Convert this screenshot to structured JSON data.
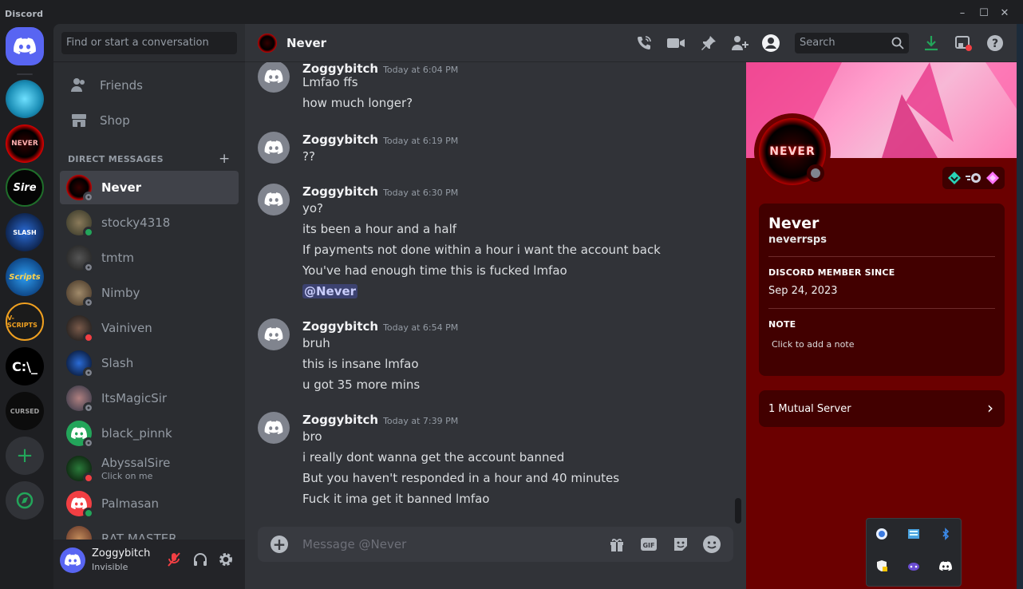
{
  "window": {
    "title": "Discord"
  },
  "dm_sidebar": {
    "search_placeholder": "Find or start a conversation",
    "nav": [
      {
        "label": "Friends"
      },
      {
        "label": "Shop"
      }
    ],
    "section_label": "DIRECT MESSAGES",
    "dms": [
      {
        "name": "Never",
        "status": "offline",
        "active": true
      },
      {
        "name": "stocky4318",
        "status": "online"
      },
      {
        "name": "tmtm",
        "status": "offline"
      },
      {
        "name": "Nimby",
        "status": "offline"
      },
      {
        "name": "Vainiven",
        "status": "dnd"
      },
      {
        "name": "Slash",
        "status": "offline"
      },
      {
        "name": "ItsMagicSir",
        "status": "offline"
      },
      {
        "name": "black_pinnk",
        "status": "offline"
      },
      {
        "name": "AbyssalSire",
        "sub": "Click on me",
        "status": "dnd"
      },
      {
        "name": "Palmasan",
        "status": "online"
      },
      {
        "name": "RAT MASTER",
        "status": "offline"
      }
    ]
  },
  "user_panel": {
    "name": "Zoggybitch",
    "status": "Invisible"
  },
  "chat": {
    "header_name": "Never",
    "search_placeholder": "Search",
    "composer_placeholder": "Message @Never",
    "messages": [
      {
        "user": "Zoggybitch",
        "time": "Today at 6:04 PM",
        "lines": [
          "Lmfao ffs",
          "how much longer?"
        ]
      },
      {
        "user": "Zoggybitch",
        "time": "Today at 6:19 PM",
        "lines": [
          "??"
        ]
      },
      {
        "user": "Zoggybitch",
        "time": "Today at 6:30 PM",
        "lines": [
          "yo?",
          "its been a hour and a half",
          "If payments not done within a hour i want the account back",
          "You've had enough time this is fucked lmfao"
        ],
        "mention": "@Never"
      },
      {
        "user": "Zoggybitch",
        "time": "Today at 6:54 PM",
        "lines": [
          "bruh",
          "this is insane lmfao",
          "u got 35 more mins"
        ]
      },
      {
        "user": "Zoggybitch",
        "time": "Today at 7:39 PM",
        "lines": [
          "bro",
          "i really dont wanna get the account banned",
          "But you haven't responded in a hour and 40 minutes",
          "Fuck it ima get it banned lmfao"
        ]
      }
    ]
  },
  "profile": {
    "avatar_text": "NEVER",
    "name": "Never",
    "handle": "neverrsps",
    "member_since_label": "DISCORD MEMBER SINCE",
    "member_since": "Sep 24, 2023",
    "note_label": "NOTE",
    "note_placeholder": "Click to add a note",
    "mutual_servers": "1 Mutual Server"
  },
  "servers": [
    {
      "name": "blue-ghost"
    },
    {
      "name": "never",
      "text": "NEVER"
    },
    {
      "name": "sire",
      "text": "Sire"
    },
    {
      "name": "slash-service",
      "text": "SLASH"
    },
    {
      "name": "scripts",
      "text": "Scripts"
    },
    {
      "name": "v-scripts",
      "text": "V-SCRIPTS"
    },
    {
      "name": "cmd",
      "text": "C:\\_"
    },
    {
      "name": "cursed",
      "text": "CURSED"
    }
  ],
  "colors": {
    "blurple": "#5865f2",
    "online": "#23a55a",
    "dnd": "#f23f43",
    "offline": "#80848e",
    "profile_bg": "#6b0000"
  }
}
